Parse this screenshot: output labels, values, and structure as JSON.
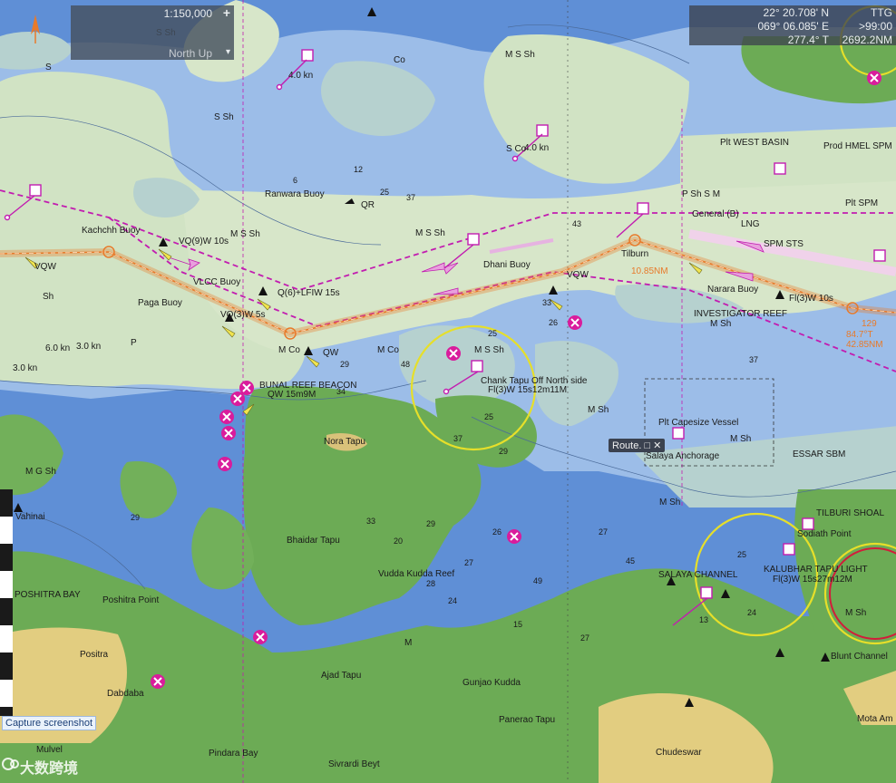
{
  "scale_panel": {
    "scale": "1:150,000",
    "orientation": "North Up",
    "zoom_in": "+",
    "dropdown": "▾"
  },
  "position_panel": {
    "latitude": "22° 20.708' N",
    "longitude": "069° 06.085' E",
    "bearing": "277.4° T",
    "ttg_label": "TTG",
    "ttg_value": ">99:00",
    "distance": "2692.2NM"
  },
  "route_chip": "Route. □ ✕",
  "capture_button": "Capture screenshot",
  "watermark": "大数跨境",
  "place_names": [
    "Kachchh Buoy",
    "Paga Buoy",
    "VLCC Buoy",
    "Dhani Buoy",
    "Ranwara Buoy",
    "Tilburn",
    "Narara Buoy",
    "INVESTIGATOR REEF",
    "BUNAL REEF BEACON",
    "Chank Tapu Off North side",
    "Nora Tapu",
    "Bhaidar Tapu",
    "Vudda Kudda Reef",
    "Gunjao Kudda",
    "Ajad Tapu",
    "POSHITRA BAY",
    "Poshitra Point",
    "Positra",
    "Dabdaba",
    "Pindara Bay",
    "Sivrardi Beyt",
    "Panerao Tapu",
    "Chudeswar",
    "Plt Capesize Vessel",
    "Salaya Anchorage",
    "ESSAR SBM",
    "Plt WEST BASIN",
    "Prod HMEL SPM",
    "Plt SPM",
    "General (B)",
    "LNG",
    "SPM STS",
    "KALUBHAR TAPU LIGHT",
    "SALAYA CHANNEL",
    "Blunt Channel",
    "Sodiath Point",
    "TILBURI SHOAL",
    "Mota Am",
    "Mulvel",
    "Vahinai"
  ],
  "light_labels": [
    "VQ(9)W 10s",
    "VQW",
    "VQ(3)W 5s",
    "Q(6)+LFIW 15s",
    "QW",
    "QW 15m9M",
    "Fl(3)W 15s12m11M",
    "Fl(3)W 15s27m12M",
    "Fl(3)W 10s",
    "QR"
  ],
  "seabed_labels": [
    "M S Sh",
    "M Sh",
    "S Sh",
    "M Co",
    "Co",
    "S",
    "Sh",
    "P",
    "M",
    "S Co",
    "P Sh S M",
    "M G Sh"
  ],
  "current_labels": [
    "4.0 kn",
    "3.0 kn",
    "6.0 kn"
  ],
  "route_labels": [
    "10.85NM",
    "84.7°T",
    "42.85NM",
    "129"
  ],
  "soundings": [
    "25",
    "25",
    "26",
    "37",
    "25",
    "29",
    "28",
    "27",
    "33",
    "37",
    "43",
    "48",
    "29",
    "34",
    "27",
    "24",
    "13",
    "25",
    "29",
    "12",
    "6",
    "37",
    "26",
    "49",
    "15",
    "27",
    "45",
    "33",
    "20",
    "29",
    "24"
  ],
  "colors": {
    "deep": "#5f8fd6",
    "mid": "#a8c6ec",
    "shallow": "#d3e4c6",
    "drying": "#bfd8d8",
    "land_green": "#6fad56",
    "land_sand": "#e3cf83",
    "route": "#e87a2a",
    "boundary": "#c21cb0",
    "danger": "#d91c9c",
    "ring": "#e6df2a"
  }
}
